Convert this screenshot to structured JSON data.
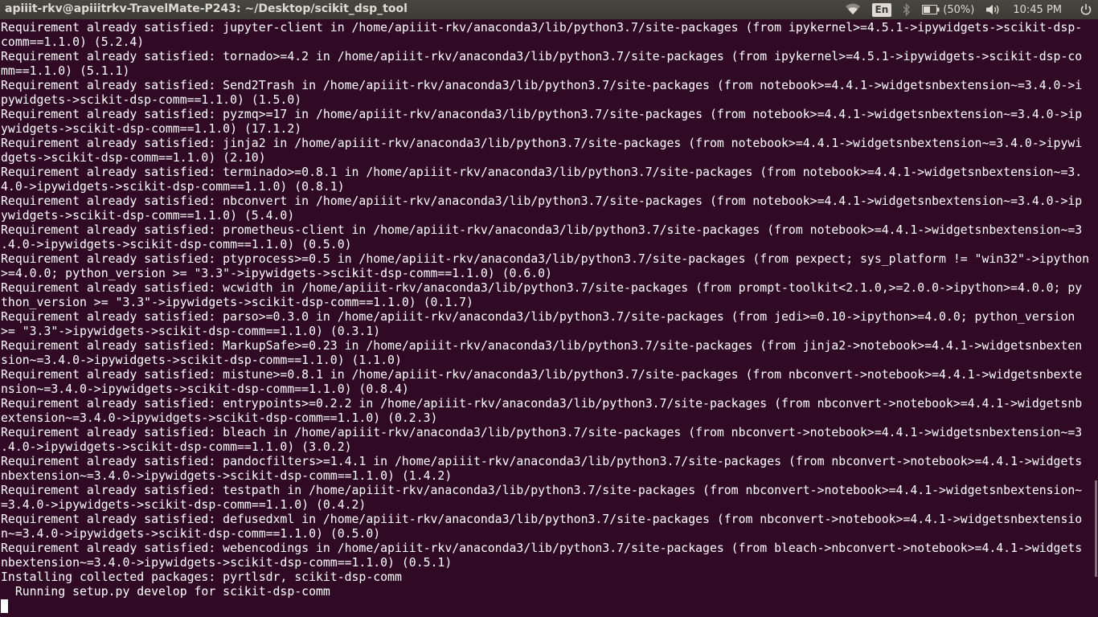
{
  "topbar": {
    "window_title": "apiiit-rkv@apiiitrkv-TravelMate-P243: ~/Desktop/scikit_dsp_tool",
    "wifi_icon": "wifi-icon",
    "keyboard_layout": "En",
    "bluetooth_icon": "bluetooth-icon",
    "battery_icon": "battery-icon",
    "battery_text": "(50%)",
    "volume_icon": "volume-icon",
    "clock": "10:45 PM",
    "power_icon": "power-icon"
  },
  "colors": {
    "terminal_bg": "#300a24",
    "terminal_fg": "#ffffff",
    "panel_bg": "#3c3b37"
  },
  "terminal": {
    "lines": [
      "Requirement already satisfied: jupyter-client in /home/apiiit-rkv/anaconda3/lib/python3.7/site-packages (from ipykernel>=4.5.1->ipywidgets->scikit-dsp-",
      "comm==1.1.0) (5.2.4)",
      "Requirement already satisfied: tornado>=4.2 in /home/apiiit-rkv/anaconda3/lib/python3.7/site-packages (from ipykernel>=4.5.1->ipywidgets->scikit-dsp-co",
      "mm==1.1.0) (5.1.1)",
      "Requirement already satisfied: Send2Trash in /home/apiiit-rkv/anaconda3/lib/python3.7/site-packages (from notebook>=4.4.1->widgetsnbextension~=3.4.0->i",
      "pywidgets->scikit-dsp-comm==1.1.0) (1.5.0)",
      "Requirement already satisfied: pyzmq>=17 in /home/apiiit-rkv/anaconda3/lib/python3.7/site-packages (from notebook>=4.4.1->widgetsnbextension~=3.4.0->ip",
      "ywidgets->scikit-dsp-comm==1.1.0) (17.1.2)",
      "Requirement already satisfied: jinja2 in /home/apiiit-rkv/anaconda3/lib/python3.7/site-packages (from notebook>=4.4.1->widgetsnbextension~=3.4.0->ipywi",
      "dgets->scikit-dsp-comm==1.1.0) (2.10)",
      "Requirement already satisfied: terminado>=0.8.1 in /home/apiiit-rkv/anaconda3/lib/python3.7/site-packages (from notebook>=4.4.1->widgetsnbextension~=3.",
      "4.0->ipywidgets->scikit-dsp-comm==1.1.0) (0.8.1)",
      "Requirement already satisfied: nbconvert in /home/apiiit-rkv/anaconda3/lib/python3.7/site-packages (from notebook>=4.4.1->widgetsnbextension~=3.4.0->ip",
      "ywidgets->scikit-dsp-comm==1.1.0) (5.4.0)",
      "Requirement already satisfied: prometheus-client in /home/apiiit-rkv/anaconda3/lib/python3.7/site-packages (from notebook>=4.4.1->widgetsnbextension~=3",
      ".4.0->ipywidgets->scikit-dsp-comm==1.1.0) (0.5.0)",
      "Requirement already satisfied: ptyprocess>=0.5 in /home/apiiit-rkv/anaconda3/lib/python3.7/site-packages (from pexpect; sys_platform != \"win32\"->ipython",
      ">=4.0.0; python_version >= \"3.3\"->ipywidgets->scikit-dsp-comm==1.1.0) (0.6.0)",
      "Requirement already satisfied: wcwidth in /home/apiiit-rkv/anaconda3/lib/python3.7/site-packages (from prompt-toolkit<2.1.0,>=2.0.0->ipython>=4.0.0; py",
      "thon_version >= \"3.3\"->ipywidgets->scikit-dsp-comm==1.1.0) (0.1.7)",
      "Requirement already satisfied: parso>=0.3.0 in /home/apiiit-rkv/anaconda3/lib/python3.7/site-packages (from jedi>=0.10->ipython>=4.0.0; python_version",
      ">= \"3.3\"->ipywidgets->scikit-dsp-comm==1.1.0) (0.3.1)",
      "Requirement already satisfied: MarkupSafe>=0.23 in /home/apiiit-rkv/anaconda3/lib/python3.7/site-packages (from jinja2->notebook>=4.4.1->widgetsnbexten",
      "sion~=3.4.0->ipywidgets->scikit-dsp-comm==1.1.0) (1.1.0)",
      "Requirement already satisfied: mistune>=0.8.1 in /home/apiiit-rkv/anaconda3/lib/python3.7/site-packages (from nbconvert->notebook>=4.4.1->widgetsnbexte",
      "nsion~=3.4.0->ipywidgets->scikit-dsp-comm==1.1.0) (0.8.4)",
      "Requirement already satisfied: entrypoints>=0.2.2 in /home/apiiit-rkv/anaconda3/lib/python3.7/site-packages (from nbconvert->notebook>=4.4.1->widgetsnb",
      "extension~=3.4.0->ipywidgets->scikit-dsp-comm==1.1.0) (0.2.3)",
      "Requirement already satisfied: bleach in /home/apiiit-rkv/anaconda3/lib/python3.7/site-packages (from nbconvert->notebook>=4.4.1->widgetsnbextension~=3",
      ".4.0->ipywidgets->scikit-dsp-comm==1.1.0) (3.0.2)",
      "Requirement already satisfied: pandocfilters>=1.4.1 in /home/apiiit-rkv/anaconda3/lib/python3.7/site-packages (from nbconvert->notebook>=4.4.1->widgets",
      "nbextension~=3.4.0->ipywidgets->scikit-dsp-comm==1.1.0) (1.4.2)",
      "Requirement already satisfied: testpath in /home/apiiit-rkv/anaconda3/lib/python3.7/site-packages (from nbconvert->notebook>=4.4.1->widgetsnbextension~",
      "=3.4.0->ipywidgets->scikit-dsp-comm==1.1.0) (0.4.2)",
      "Requirement already satisfied: defusedxml in /home/apiiit-rkv/anaconda3/lib/python3.7/site-packages (from nbconvert->notebook>=4.4.1->widgetsnbextensio",
      "n~=3.4.0->ipywidgets->scikit-dsp-comm==1.1.0) (0.5.0)",
      "Requirement already satisfied: webencodings in /home/apiiit-rkv/anaconda3/lib/python3.7/site-packages (from bleach->nbconvert->notebook>=4.4.1->widgets",
      "nbextension~=3.4.0->ipywidgets->scikit-dsp-comm==1.1.0) (0.5.1)",
      "Installing collected packages: pyrtlsdr, scikit-dsp-comm",
      "  Running setup.py develop for scikit-dsp-comm"
    ]
  }
}
